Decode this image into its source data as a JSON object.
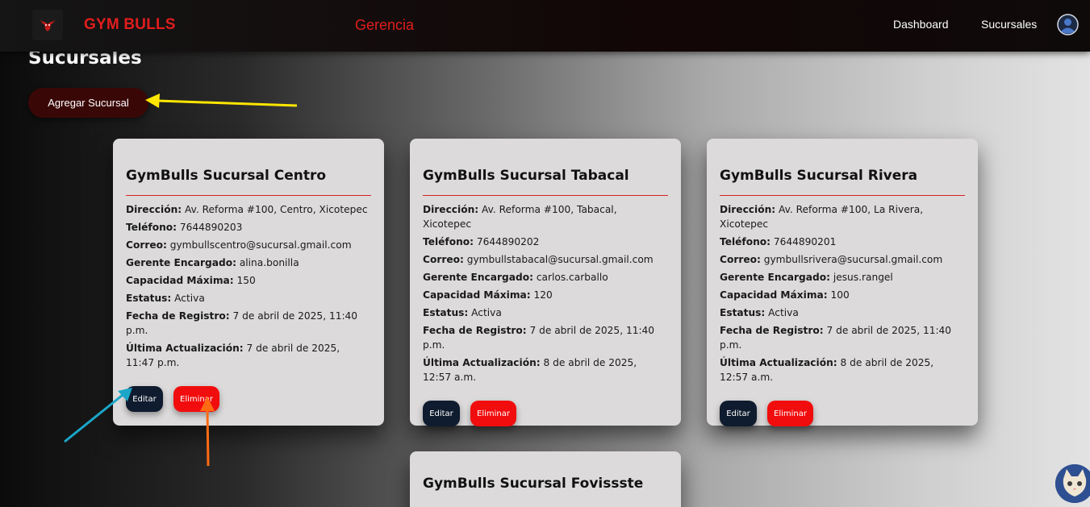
{
  "navbar": {
    "brand": "GYM BULLS",
    "center_title": "Gerencia",
    "links": [
      "Dashboard",
      "Sucursales"
    ]
  },
  "page": {
    "title": "Sucursales",
    "add_button": "Agregar Sucursal"
  },
  "labels": {
    "direccion": "Dirección:",
    "telefono": "Teléfono:",
    "correo": "Correo:",
    "gerente": "Gerente Encargado:",
    "capacidad": "Capacidad Máxima:",
    "estatus": "Estatus:",
    "registro": "Fecha de Registro:",
    "actualizacion": "Última Actualización:",
    "edit": "Editar",
    "delete": "Eliminar"
  },
  "branches": [
    {
      "name": "GymBulls Sucursal Centro",
      "direccion": "Av. Reforma #100, Centro, Xicotepec",
      "telefono": "7644890203",
      "correo": "gymbullscentro@sucursal.gmail.com",
      "gerente": "alina.bonilla",
      "capacidad": "150",
      "estatus": "Activa",
      "registro": "7 de abril de 2025, 11:40 p.m.",
      "actualizacion": "7 de abril de 2025, 11:47 p.m."
    },
    {
      "name": "GymBulls Sucursal Tabacal",
      "direccion": "Av. Reforma #100, Tabacal, Xicotepec",
      "telefono": "7644890202",
      "correo": "gymbullstabacal@sucursal.gmail.com",
      "gerente": "carlos.carballo",
      "capacidad": "120",
      "estatus": "Activa",
      "registro": "7 de abril de 2025, 11:40 p.m.",
      "actualizacion": "8 de abril de 2025, 12:57 a.m."
    },
    {
      "name": "GymBulls Sucursal Rivera",
      "direccion": "Av. Reforma #100, La Rivera, Xicotepec",
      "telefono": "7644890201",
      "correo": "gymbullsrivera@sucursal.gmail.com",
      "gerente": "jesus.rangel",
      "capacidad": "100",
      "estatus": "Activa",
      "registro": "7 de abril de 2025, 11:40 p.m.",
      "actualizacion": "8 de abril de 2025, 12:57 a.m."
    },
    {
      "name": "GymBulls Sucursal Fovissste"
    }
  ],
  "annotations": {
    "arrow_colors": [
      "#ffe600",
      "#1aa6c8",
      "#ff6a13"
    ]
  }
}
